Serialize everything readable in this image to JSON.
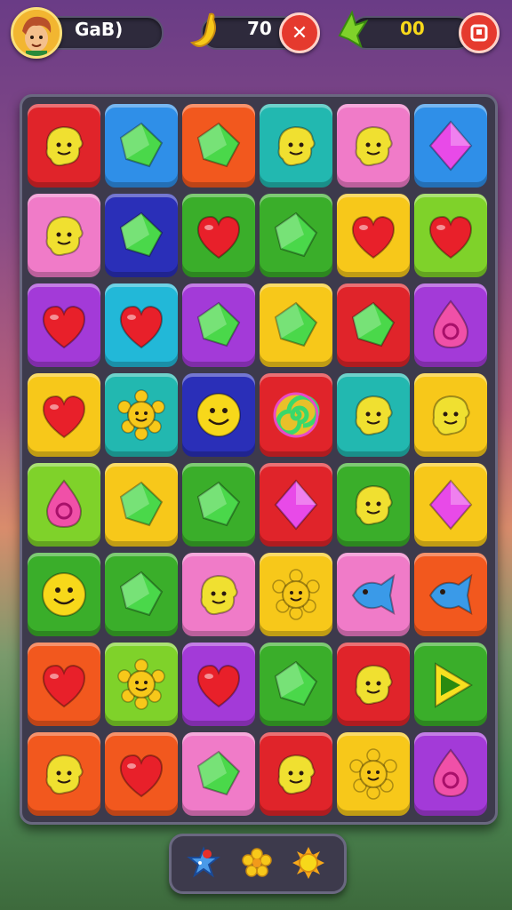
{
  "header": {
    "player_name": "GaB)",
    "score_value": "70",
    "moves_value": "00"
  },
  "colors": {
    "red": "#e0242a",
    "blue": "#2f8fe8",
    "orange": "#f2581e",
    "teal": "#22b8b0",
    "pink": "#f07bc8",
    "green": "#3aae2a",
    "navy": "#2a2fb8",
    "yellow": "#f7c81a",
    "purple": "#a33ad8",
    "cyan": "#22b8d8",
    "lime": "#7fd22a"
  },
  "board": [
    [
      {
        "bg": "red",
        "icon": "smiley-blob-icon"
      },
      {
        "bg": "blue",
        "icon": "gem-icon"
      },
      {
        "bg": "orange",
        "icon": "gem-icon"
      },
      {
        "bg": "teal",
        "icon": "smiley-blob-icon"
      },
      {
        "bg": "pink",
        "icon": "smiley-blob-icon"
      },
      {
        "bg": "blue",
        "icon": "diamond-icon"
      }
    ],
    [
      {
        "bg": "pink",
        "icon": "smiley-blob-icon"
      },
      {
        "bg": "navy",
        "icon": "gem-icon"
      },
      {
        "bg": "green",
        "icon": "heart-icon"
      },
      {
        "bg": "green",
        "icon": "gem-icon"
      },
      {
        "bg": "yellow",
        "icon": "heart-icon"
      },
      {
        "bg": "lime",
        "icon": "heart-icon"
      }
    ],
    [
      {
        "bg": "purple",
        "icon": "heart-icon"
      },
      {
        "bg": "cyan",
        "icon": "heart-icon"
      },
      {
        "bg": "purple",
        "icon": "gem-icon"
      },
      {
        "bg": "yellow",
        "icon": "gem-icon"
      },
      {
        "bg": "red",
        "icon": "gem-icon"
      },
      {
        "bg": "purple",
        "icon": "drop-icon"
      }
    ],
    [
      {
        "bg": "yellow",
        "icon": "heart-icon"
      },
      {
        "bg": "teal",
        "icon": "sun-icon"
      },
      {
        "bg": "navy",
        "icon": "smiley-icon"
      },
      {
        "bg": "red",
        "icon": "swirl-icon"
      },
      {
        "bg": "teal",
        "icon": "smiley-blob-icon"
      },
      {
        "bg": "yellow",
        "icon": "smiley-blob-icon"
      }
    ],
    [
      {
        "bg": "lime",
        "icon": "drop-icon"
      },
      {
        "bg": "yellow",
        "icon": "gem-icon"
      },
      {
        "bg": "green",
        "icon": "gem-icon"
      },
      {
        "bg": "red",
        "icon": "diamond-icon"
      },
      {
        "bg": "green",
        "icon": "smiley-blob-icon"
      },
      {
        "bg": "yellow",
        "icon": "diamond-icon"
      }
    ],
    [
      {
        "bg": "green",
        "icon": "smiley-icon"
      },
      {
        "bg": "green",
        "icon": "gem-icon"
      },
      {
        "bg": "pink",
        "icon": "smiley-blob-icon"
      },
      {
        "bg": "yellow",
        "icon": "sun-icon"
      },
      {
        "bg": "pink",
        "icon": "fish-icon"
      },
      {
        "bg": "orange",
        "icon": "fish-icon"
      }
    ],
    [
      {
        "bg": "orange",
        "icon": "heart-icon"
      },
      {
        "bg": "lime",
        "icon": "sun-icon"
      },
      {
        "bg": "purple",
        "icon": "heart-icon"
      },
      {
        "bg": "green",
        "icon": "gem-icon"
      },
      {
        "bg": "red",
        "icon": "smiley-blob-icon"
      },
      {
        "bg": "green",
        "icon": "triangle-icon"
      }
    ],
    [
      {
        "bg": "orange",
        "icon": "smiley-blob-icon"
      },
      {
        "bg": "orange",
        "icon": "heart-icon"
      },
      {
        "bg": "pink",
        "icon": "gem-icon"
      },
      {
        "bg": "red",
        "icon": "smiley-blob-icon"
      },
      {
        "bg": "yellow",
        "icon": "sun-icon"
      },
      {
        "bg": "purple",
        "icon": "drop-icon"
      }
    ]
  ],
  "icon_colors": {
    "smiley-blob-icon": "#f0e030",
    "gem-icon": "#4ad84a",
    "diamond-icon": "#e84ae8",
    "heart-icon": "#e8202a",
    "drop-icon": "#f050a8",
    "sun-icon": "#f7c81a",
    "smiley-icon": "#f7d81a",
    "swirl-icon": "#e8602a",
    "fish-icon": "#3a9ae8",
    "triangle-icon": "#f7e020"
  },
  "tray": {
    "tools": [
      "star-bird-icon",
      "flower-icon",
      "sun-icon"
    ]
  }
}
